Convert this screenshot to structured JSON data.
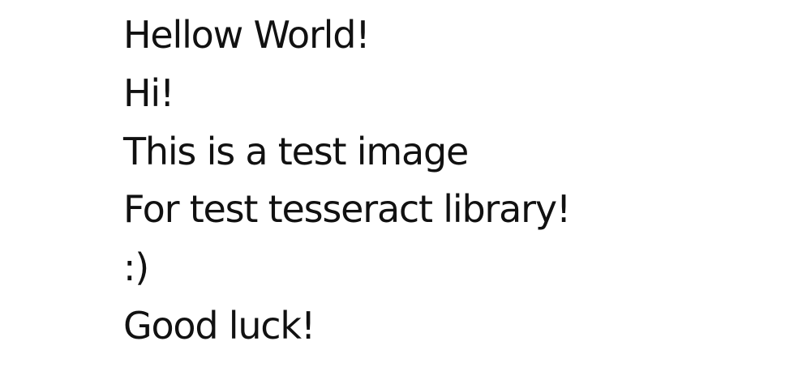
{
  "lines": [
    "Hellow World!",
    "Hi!",
    "This is a test image",
    "For test tesseract library!",
    ":)",
    "Good luck!"
  ],
  "colors": {
    "background": "#ffffff",
    "text": "#111111"
  }
}
